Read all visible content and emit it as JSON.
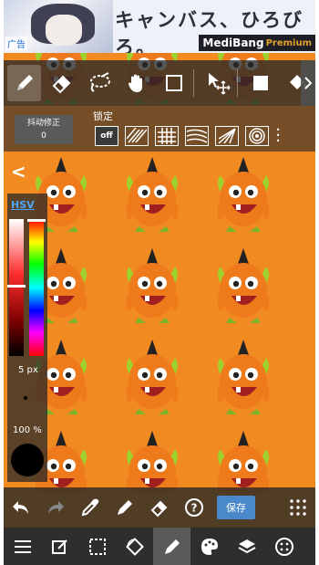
{
  "ad": {
    "headline": "キャンバス、ひろびろ。",
    "label": "广告",
    "brand": "MediBang",
    "brand_suffix": "Premium"
  },
  "toolbar": {
    "tools": [
      "pen-icon",
      "eraser-icon",
      "lasso-icon",
      "hand-icon",
      "rectangle-icon",
      "move-icon",
      "fill-square-icon",
      "bucket-icon"
    ],
    "active_tool": "pen-icon"
  },
  "subbar": {
    "stabilizer_label": "抖动修正",
    "stabilizer_value": "0",
    "lock_label": "锁定",
    "snap_off_label": "off",
    "snaps": [
      "off",
      "parallel-lines",
      "grid",
      "curve-lines",
      "perspective",
      "concentric"
    ]
  },
  "colorpanel": {
    "mode": "HSV",
    "brush_size": "5 px",
    "opacity": "100 %",
    "current_color": "#000000"
  },
  "bottombar": {
    "save_label": "保存"
  },
  "colors": {
    "canvas_bg": "#f28a22",
    "accent": "#4a89c9",
    "monster_body": "#ee7a1b"
  }
}
